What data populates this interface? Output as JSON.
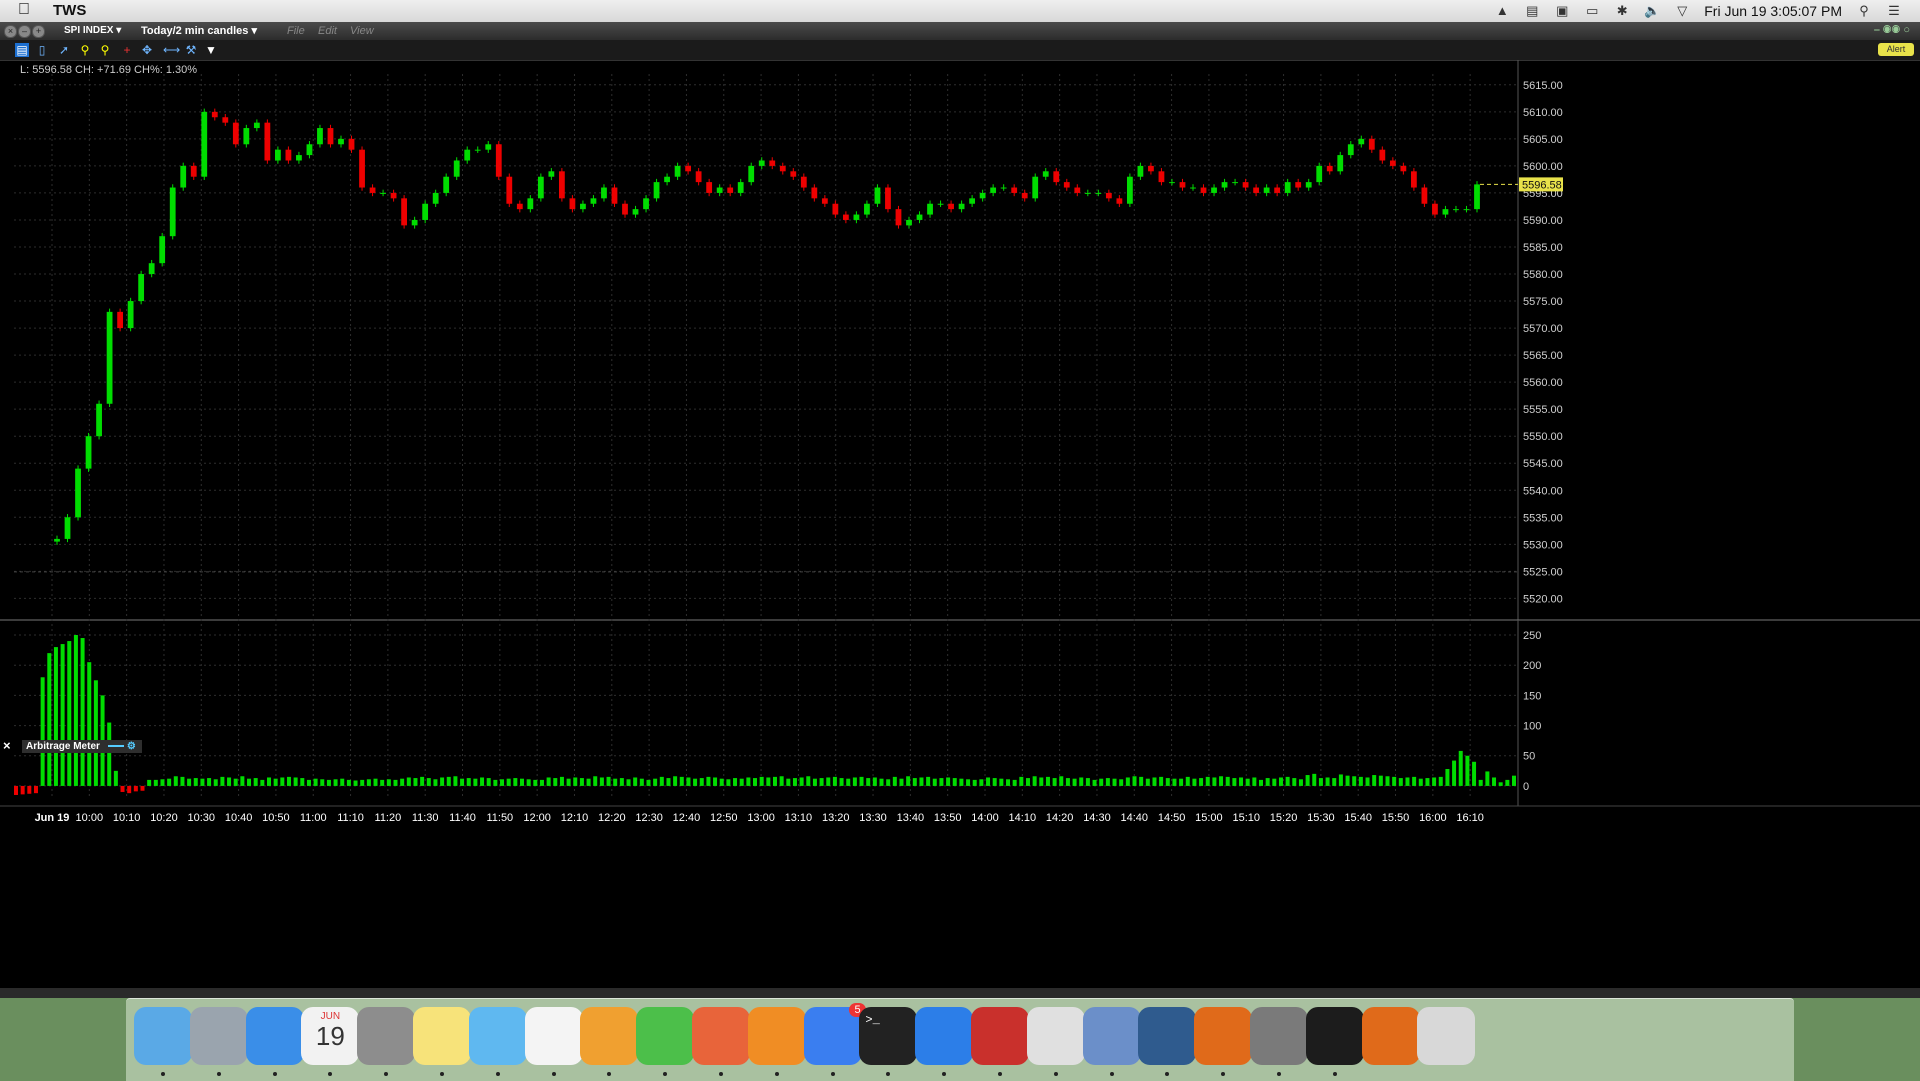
{
  "menubar": {
    "app_name": "TWS",
    "clock": "Fri Jun 19  3:05:07 PM"
  },
  "window": {
    "symbol": "SPI INDEX",
    "period": "Today/2 min candles",
    "menus": [
      "File",
      "Edit",
      "View"
    ],
    "alert_label": "Alert"
  },
  "info_line": "L: 5596.58  CH: +71.69  CH%: 1.30%",
  "indicator": {
    "name": "Arbitrage Meter"
  },
  "colors": {
    "up": "#00dd00",
    "down": "#ee0000",
    "grid": "#2e2e2e",
    "text": "#d0d0d0",
    "last_price_bg": "#e8e24a"
  },
  "chart_data": [
    {
      "type": "candlestick",
      "title": "SPI INDEX Today/2 min candles",
      "ylim": [
        5516,
        5617
      ],
      "y_ticks": [
        "5615.00",
        "5610.00",
        "5605.00",
        "5600.00",
        "5595.00",
        "5590.00",
        "5585.00",
        "5580.00",
        "5575.00",
        "5570.00",
        "5565.00",
        "5560.00",
        "5555.00",
        "5550.00",
        "5545.00",
        "5540.00",
        "5535.00",
        "5530.00",
        "5525.00",
        "5520.00"
      ],
      "y_tick_values": [
        5615,
        5610,
        5605,
        5600,
        5595,
        5590,
        5585,
        5580,
        5575,
        5570,
        5565,
        5560,
        5555,
        5550,
        5545,
        5540,
        5535,
        5530,
        5525,
        5520
      ],
      "x_ticks": [
        "Jun 19",
        "10:00",
        "10:10",
        "10:20",
        "10:30",
        "10:40",
        "10:50",
        "11:00",
        "11:10",
        "11:20",
        "11:30",
        "11:40",
        "11:50",
        "12:00",
        "12:10",
        "12:20",
        "12:30",
        "12:40",
        "12:50",
        "13:00",
        "13:10",
        "13:20",
        "13:30",
        "13:40",
        "13:50",
        "14:00",
        "14:10",
        "14:20",
        "14:30",
        "14:40",
        "14:50",
        "15:00",
        "15:10",
        "15:20",
        "15:30",
        "15:40",
        "15:50",
        "16:00",
        "16:10"
      ],
      "last_price": "5596.58",
      "prev_close_ref": 5524.9,
      "closes": [
        5531.0,
        5535.0,
        5544.0,
        5550.0,
        5556.0,
        5573.0,
        5570.0,
        5575.0,
        5580.0,
        5582.0,
        5587.0,
        5596.0,
        5600.0,
        5598.0,
        5610.0,
        5609.0,
        5608.0,
        5604.0,
        5607.0,
        5608.0,
        5601.0,
        5603.0,
        5601.0,
        5602.0,
        5604.0,
        5607.0,
        5604.0,
        5605.0,
        5603.0,
        5596.0,
        5595.0,
        5595.0,
        5594.0,
        5589.0,
        5590.0,
        5593.0,
        5595.0,
        5598.0,
        5601.0,
        5603.0,
        5603.0,
        5604.0,
        5598.0,
        5593.0,
        5592.0,
        5594.0,
        5598.0,
        5599.0,
        5594.0,
        5592.0,
        5593.0,
        5594.0,
        5596.0,
        5593.0,
        5591.0,
        5592.0,
        5594.0,
        5597.0,
        5598.0,
        5600.0,
        5599.0,
        5597.0,
        5595.0,
        5596.0,
        5595.0,
        5597.0,
        5600.0,
        5601.0,
        5600.0,
        5599.0,
        5598.0,
        5596.0,
        5594.0,
        5593.0,
        5591.0,
        5590.0,
        5591.0,
        5593.0,
        5596.0,
        5592.0,
        5589.0,
        5590.0,
        5591.0,
        5593.0,
        5593.0,
        5592.0,
        5593.0,
        5594.0,
        5595.0,
        5596.0,
        5596.0,
        5595.0,
        5594.0,
        5598.0,
        5599.0,
        5597.0,
        5596.0,
        5595.0,
        5595.0,
        5595.0,
        5594.0,
        5593.0,
        5598.0,
        5600.0,
        5599.0,
        5597.0,
        5597.0,
        5596.0,
        5596.0,
        5595.0,
        5596.0,
        5597.0,
        5597.0,
        5596.0,
        5595.0,
        5596.0,
        5595.0,
        5597.0,
        5596.0,
        5597.0,
        5600.0,
        5599.0,
        5602.0,
        5604.0,
        5605.0,
        5603.0,
        5601.0,
        5600.0,
        5599.0,
        5596.0,
        5593.0,
        5591.0,
        5592.0,
        5592.0,
        5592.0,
        5596.58
      ],
      "opens": [
        5530.5,
        5531.0,
        5535.0,
        5544.0,
        5550.0,
        5556.0,
        5573.0,
        5570.0,
        5575.0,
        5580.0,
        5582.0,
        5587.0,
        5596.0,
        5600.0,
        5598.0,
        5610.0,
        5609.0,
        5608.0,
        5604.0,
        5607.0,
        5608.0,
        5601.0,
        5603.0,
        5601.0,
        5602.0,
        5604.0,
        5607.0,
        5604.0,
        5605.0,
        5603.0,
        5596.0,
        5595.0,
        5595.0,
        5594.0,
        5589.0,
        5590.0,
        5593.0,
        5595.0,
        5598.0,
        5601.0,
        5603.0,
        5603.0,
        5604.0,
        5598.0,
        5593.0,
        5592.0,
        5594.0,
        5598.0,
        5599.0,
        5594.0,
        5592.0,
        5593.0,
        5594.0,
        5596.0,
        5593.0,
        5591.0,
        5592.0,
        5594.0,
        5597.0,
        5598.0,
        5600.0,
        5599.0,
        5597.0,
        5595.0,
        5596.0,
        5595.0,
        5597.0,
        5600.0,
        5601.0,
        5600.0,
        5599.0,
        5598.0,
        5596.0,
        5594.0,
        5593.0,
        5591.0,
        5590.0,
        5591.0,
        5593.0,
        5596.0,
        5592.0,
        5589.0,
        5590.0,
        5591.0,
        5593.0,
        5593.0,
        5592.0,
        5593.0,
        5594.0,
        5595.0,
        5596.0,
        5596.0,
        5595.0,
        5594.0,
        5598.0,
        5599.0,
        5597.0,
        5596.0,
        5595.0,
        5595.0,
        5595.0,
        5594.0,
        5593.0,
        5598.0,
        5600.0,
        5599.0,
        5597.0,
        5597.0,
        5596.0,
        5596.0,
        5595.0,
        5596.0,
        5597.0,
        5597.0,
        5596.0,
        5595.0,
        5596.0,
        5595.0,
        5597.0,
        5596.0,
        5597.0,
        5600.0,
        5599.0,
        5602.0,
        5604.0,
        5605.0,
        5603.0,
        5601.0,
        5600.0,
        5599.0,
        5596.0,
        5593.0,
        5591.0,
        5592.0,
        5592.0,
        5592.0
      ]
    },
    {
      "type": "bar",
      "title": "Arbitrage Meter",
      "ylim": [
        -20,
        255
      ],
      "y_ticks": [
        "250",
        "200",
        "150",
        "100",
        "50",
        "0"
      ],
      "y_tick_values": [
        250,
        200,
        150,
        100,
        50,
        0
      ],
      "values": [
        -15,
        -14,
        -13,
        -12,
        180,
        220,
        230,
        235,
        240,
        250,
        245,
        205,
        175,
        150,
        105,
        25,
        -10,
        -12,
        -9,
        -8,
        10,
        10,
        11,
        12,
        16,
        15,
        12,
        13,
        12,
        13,
        11,
        15,
        14,
        12,
        16,
        12,
        13,
        10,
        14,
        12,
        14,
        15,
        14,
        13,
        10,
        12,
        11,
        10,
        11,
        12,
        10,
        9,
        10,
        11,
        12,
        10,
        11,
        10,
        12,
        14,
        13,
        15,
        13,
        11,
        14,
        15,
        16,
        12,
        13,
        12,
        14,
        13,
        10,
        11,
        12,
        13,
        12,
        11,
        10,
        10,
        14,
        13,
        15,
        12,
        14,
        13,
        12,
        16,
        14,
        15,
        12,
        13,
        11,
        14,
        12,
        10,
        12,
        15,
        13,
        16,
        15,
        14,
        12,
        13,
        15,
        14,
        12,
        11,
        13,
        12,
        14,
        13,
        15,
        14,
        15,
        16,
        12,
        13,
        14,
        16,
        12,
        13,
        14,
        15,
        13,
        12,
        14,
        15,
        13,
        14,
        12,
        11,
        15,
        12,
        16,
        13,
        14,
        15,
        12,
        13,
        14,
        13,
        12,
        11,
        10,
        11,
        14,
        13,
        12,
        11,
        10,
        15,
        13,
        16,
        14,
        15,
        13,
        16,
        13,
        12,
        14,
        13,
        10,
        12,
        13,
        12,
        11,
        14,
        16,
        15,
        12,
        14,
        15,
        13,
        12,
        12,
        15,
        12,
        13,
        15,
        14,
        16,
        15,
        13,
        14,
        12,
        14,
        10,
        13,
        12,
        14,
        15,
        13,
        11,
        18,
        20,
        13,
        14,
        13,
        19,
        17,
        16,
        15,
        14,
        18,
        17,
        16,
        15,
        13,
        14,
        15,
        12,
        13,
        14,
        15,
        28,
        42,
        58,
        50,
        40,
        10,
        24,
        14,
        6,
        10,
        17
      ]
    }
  ],
  "dock": {
    "apps": [
      "finder-icon",
      "launchpad-icon",
      "safari-icon",
      "calendar-icon",
      "calculator-icon",
      "notes-icon",
      "messages-icon",
      "textedit-icon",
      "pages-icon",
      "numbers-icon",
      "keynote-icon",
      "ibooks-icon",
      "app-store-icon",
      "terminal-icon",
      "teamviewer-icon",
      "dvd-player-icon",
      "java-icon",
      "network-icon",
      "sourcetree-icon",
      "matlab-icon",
      "system-preferences-icon",
      "activity-monitor-icon",
      "matlab-2-icon",
      "trash-icon"
    ],
    "calendar_month": "JUN",
    "calendar_day": "19",
    "app_store_badge": "5"
  }
}
